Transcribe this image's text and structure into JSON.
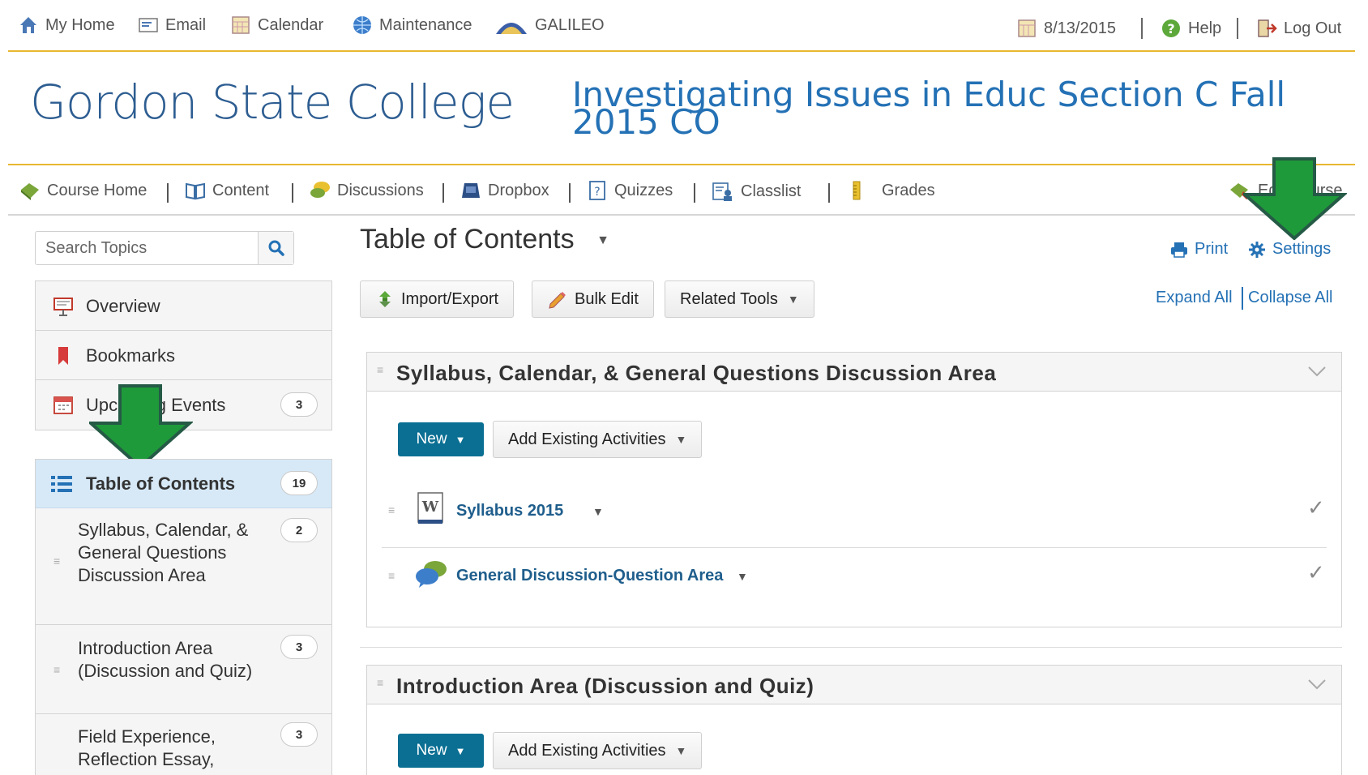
{
  "minibar": {
    "items": [
      {
        "label": "My Home",
        "icon": "home-icon"
      },
      {
        "label": "Email",
        "icon": "email-icon"
      },
      {
        "label": "Calendar",
        "icon": "calendar-icon"
      },
      {
        "label": "Maintenance",
        "icon": "globe-icon"
      },
      {
        "label": "GALILEO",
        "icon": "galileo-logo-icon"
      }
    ],
    "date": "8/13/2015",
    "help": "Help",
    "logout": "Log Out"
  },
  "header": {
    "brand": "Gordon State College",
    "course_title": "Investigating Issues in Educ Section C Fall 2015 CO"
  },
  "navbar": {
    "items": [
      "Course Home",
      "Content",
      "Discussions",
      "Dropbox",
      "Quizzes",
      "Classlist",
      "Grades"
    ],
    "edit_course": "Edit Course"
  },
  "sidebar": {
    "search_placeholder": "Search Topics",
    "items": [
      {
        "label": "Overview"
      },
      {
        "label": "Bookmarks"
      },
      {
        "label": "Upcoming Events",
        "count": "3"
      }
    ],
    "toc": {
      "label": "Table of Contents",
      "count": "19"
    },
    "modules": [
      {
        "label": "Syllabus, Calendar, & General Questions Discussion Area",
        "count": "2"
      },
      {
        "label": "Introduction Area (Discussion and Quiz)",
        "count": "3"
      },
      {
        "label": "Field Experience, Reflection Essay,",
        "count": "3"
      }
    ]
  },
  "main": {
    "title": "Table of Contents",
    "print": "Print",
    "settings": "Settings",
    "toolbar": {
      "import_export": "Import/Export",
      "bulk_edit": "Bulk Edit",
      "related_tools": "Related Tools"
    },
    "expand_all": "Expand All",
    "collapse_all": "Collapse All",
    "modules": [
      {
        "title": "Syllabus, Calendar, & General Questions Discussion Area",
        "new_label": "New",
        "add_existing": "Add Existing Activities",
        "topics": [
          {
            "label": "Syllabus 2015",
            "icon": "word-doc-icon"
          },
          {
            "label": "General Discussion-Question Area",
            "icon": "discussion-icon"
          }
        ]
      },
      {
        "title": "Introduction Area (Discussion and Quiz)",
        "new_label": "New",
        "add_existing": "Add Existing Activities"
      }
    ]
  },
  "colors": {
    "accent": "#0a6f93",
    "link": "#2471b5",
    "brand": "#2d5d91",
    "arrow": "#1f9a3a",
    "rule": "#e8b830"
  }
}
